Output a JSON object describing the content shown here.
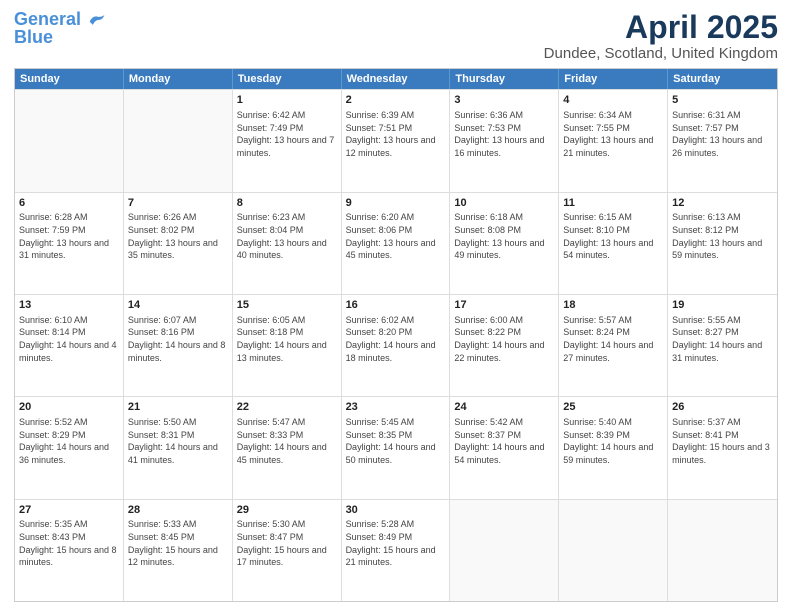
{
  "header": {
    "logo_line1": "General",
    "logo_line2": "Blue",
    "main_title": "April 2025",
    "subtitle": "Dundee, Scotland, United Kingdom"
  },
  "calendar": {
    "weekdays": [
      "Sunday",
      "Monday",
      "Tuesday",
      "Wednesday",
      "Thursday",
      "Friday",
      "Saturday"
    ],
    "rows": [
      [
        {
          "day": "",
          "text": ""
        },
        {
          "day": "",
          "text": ""
        },
        {
          "day": "1",
          "text": "Sunrise: 6:42 AM\nSunset: 7:49 PM\nDaylight: 13 hours and 7 minutes."
        },
        {
          "day": "2",
          "text": "Sunrise: 6:39 AM\nSunset: 7:51 PM\nDaylight: 13 hours and 12 minutes."
        },
        {
          "day": "3",
          "text": "Sunrise: 6:36 AM\nSunset: 7:53 PM\nDaylight: 13 hours and 16 minutes."
        },
        {
          "day": "4",
          "text": "Sunrise: 6:34 AM\nSunset: 7:55 PM\nDaylight: 13 hours and 21 minutes."
        },
        {
          "day": "5",
          "text": "Sunrise: 6:31 AM\nSunset: 7:57 PM\nDaylight: 13 hours and 26 minutes."
        }
      ],
      [
        {
          "day": "6",
          "text": "Sunrise: 6:28 AM\nSunset: 7:59 PM\nDaylight: 13 hours and 31 minutes."
        },
        {
          "day": "7",
          "text": "Sunrise: 6:26 AM\nSunset: 8:02 PM\nDaylight: 13 hours and 35 minutes."
        },
        {
          "day": "8",
          "text": "Sunrise: 6:23 AM\nSunset: 8:04 PM\nDaylight: 13 hours and 40 minutes."
        },
        {
          "day": "9",
          "text": "Sunrise: 6:20 AM\nSunset: 8:06 PM\nDaylight: 13 hours and 45 minutes."
        },
        {
          "day": "10",
          "text": "Sunrise: 6:18 AM\nSunset: 8:08 PM\nDaylight: 13 hours and 49 minutes."
        },
        {
          "day": "11",
          "text": "Sunrise: 6:15 AM\nSunset: 8:10 PM\nDaylight: 13 hours and 54 minutes."
        },
        {
          "day": "12",
          "text": "Sunrise: 6:13 AM\nSunset: 8:12 PM\nDaylight: 13 hours and 59 minutes."
        }
      ],
      [
        {
          "day": "13",
          "text": "Sunrise: 6:10 AM\nSunset: 8:14 PM\nDaylight: 14 hours and 4 minutes."
        },
        {
          "day": "14",
          "text": "Sunrise: 6:07 AM\nSunset: 8:16 PM\nDaylight: 14 hours and 8 minutes."
        },
        {
          "day": "15",
          "text": "Sunrise: 6:05 AM\nSunset: 8:18 PM\nDaylight: 14 hours and 13 minutes."
        },
        {
          "day": "16",
          "text": "Sunrise: 6:02 AM\nSunset: 8:20 PM\nDaylight: 14 hours and 18 minutes."
        },
        {
          "day": "17",
          "text": "Sunrise: 6:00 AM\nSunset: 8:22 PM\nDaylight: 14 hours and 22 minutes."
        },
        {
          "day": "18",
          "text": "Sunrise: 5:57 AM\nSunset: 8:24 PM\nDaylight: 14 hours and 27 minutes."
        },
        {
          "day": "19",
          "text": "Sunrise: 5:55 AM\nSunset: 8:27 PM\nDaylight: 14 hours and 31 minutes."
        }
      ],
      [
        {
          "day": "20",
          "text": "Sunrise: 5:52 AM\nSunset: 8:29 PM\nDaylight: 14 hours and 36 minutes."
        },
        {
          "day": "21",
          "text": "Sunrise: 5:50 AM\nSunset: 8:31 PM\nDaylight: 14 hours and 41 minutes."
        },
        {
          "day": "22",
          "text": "Sunrise: 5:47 AM\nSunset: 8:33 PM\nDaylight: 14 hours and 45 minutes."
        },
        {
          "day": "23",
          "text": "Sunrise: 5:45 AM\nSunset: 8:35 PM\nDaylight: 14 hours and 50 minutes."
        },
        {
          "day": "24",
          "text": "Sunrise: 5:42 AM\nSunset: 8:37 PM\nDaylight: 14 hours and 54 minutes."
        },
        {
          "day": "25",
          "text": "Sunrise: 5:40 AM\nSunset: 8:39 PM\nDaylight: 14 hours and 59 minutes."
        },
        {
          "day": "26",
          "text": "Sunrise: 5:37 AM\nSunset: 8:41 PM\nDaylight: 15 hours and 3 minutes."
        }
      ],
      [
        {
          "day": "27",
          "text": "Sunrise: 5:35 AM\nSunset: 8:43 PM\nDaylight: 15 hours and 8 minutes."
        },
        {
          "day": "28",
          "text": "Sunrise: 5:33 AM\nSunset: 8:45 PM\nDaylight: 15 hours and 12 minutes."
        },
        {
          "day": "29",
          "text": "Sunrise: 5:30 AM\nSunset: 8:47 PM\nDaylight: 15 hours and 17 minutes."
        },
        {
          "day": "30",
          "text": "Sunrise: 5:28 AM\nSunset: 8:49 PM\nDaylight: 15 hours and 21 minutes."
        },
        {
          "day": "",
          "text": ""
        },
        {
          "day": "",
          "text": ""
        },
        {
          "day": "",
          "text": ""
        }
      ]
    ]
  }
}
